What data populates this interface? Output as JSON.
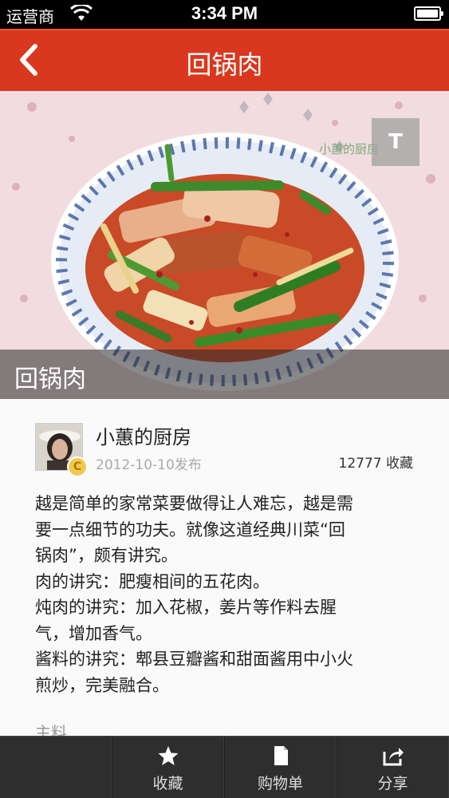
{
  "status_bar": {
    "carrier": "运营商",
    "time": "3:34 PM",
    "wifi_icon": "wifi-icon",
    "battery_icon": "battery-icon"
  },
  "nav_bar": {
    "back_icon": "chevron-left-icon",
    "title": "回锅肉"
  },
  "hero": {
    "watermark": "小蕙的厨房",
    "text_toggle_label": "T",
    "caption": "回锅肉"
  },
  "author": {
    "name": "小蕙的厨房",
    "badge": "C",
    "publish_date": "2012-10-10发布",
    "favorites": "12777 收藏"
  },
  "description": {
    "paragraph_1": "越是简单的家常菜要做得让人难忘，越是需\n要一点细节的功夫。就像这道经典川菜“回\n锅肉”，颇有讲究。",
    "paragraph_2": "肉的讲究：肥瘦相间的五花肉。",
    "paragraph_3": "炖肉的讲究：加入花椒，姜片等作料去腥\n气，增加香气。",
    "paragraph_4": "酱料的讲究：郫县豆瓣酱和甜面酱用中小火\n煎炒，完美融合。"
  },
  "ingredients_label": "主料",
  "tab_bar": {
    "tabs": [
      {
        "label": "",
        "icon": ""
      },
      {
        "label": "收藏",
        "icon": "star-icon"
      },
      {
        "label": "购物单",
        "icon": "document-icon"
      },
      {
        "label": "分享",
        "icon": "share-icon"
      }
    ]
  },
  "colors": {
    "nav_red": "#d9381e",
    "tab_bar_bg": "#2e2e2e",
    "badge_gold": "#f2c94c"
  }
}
